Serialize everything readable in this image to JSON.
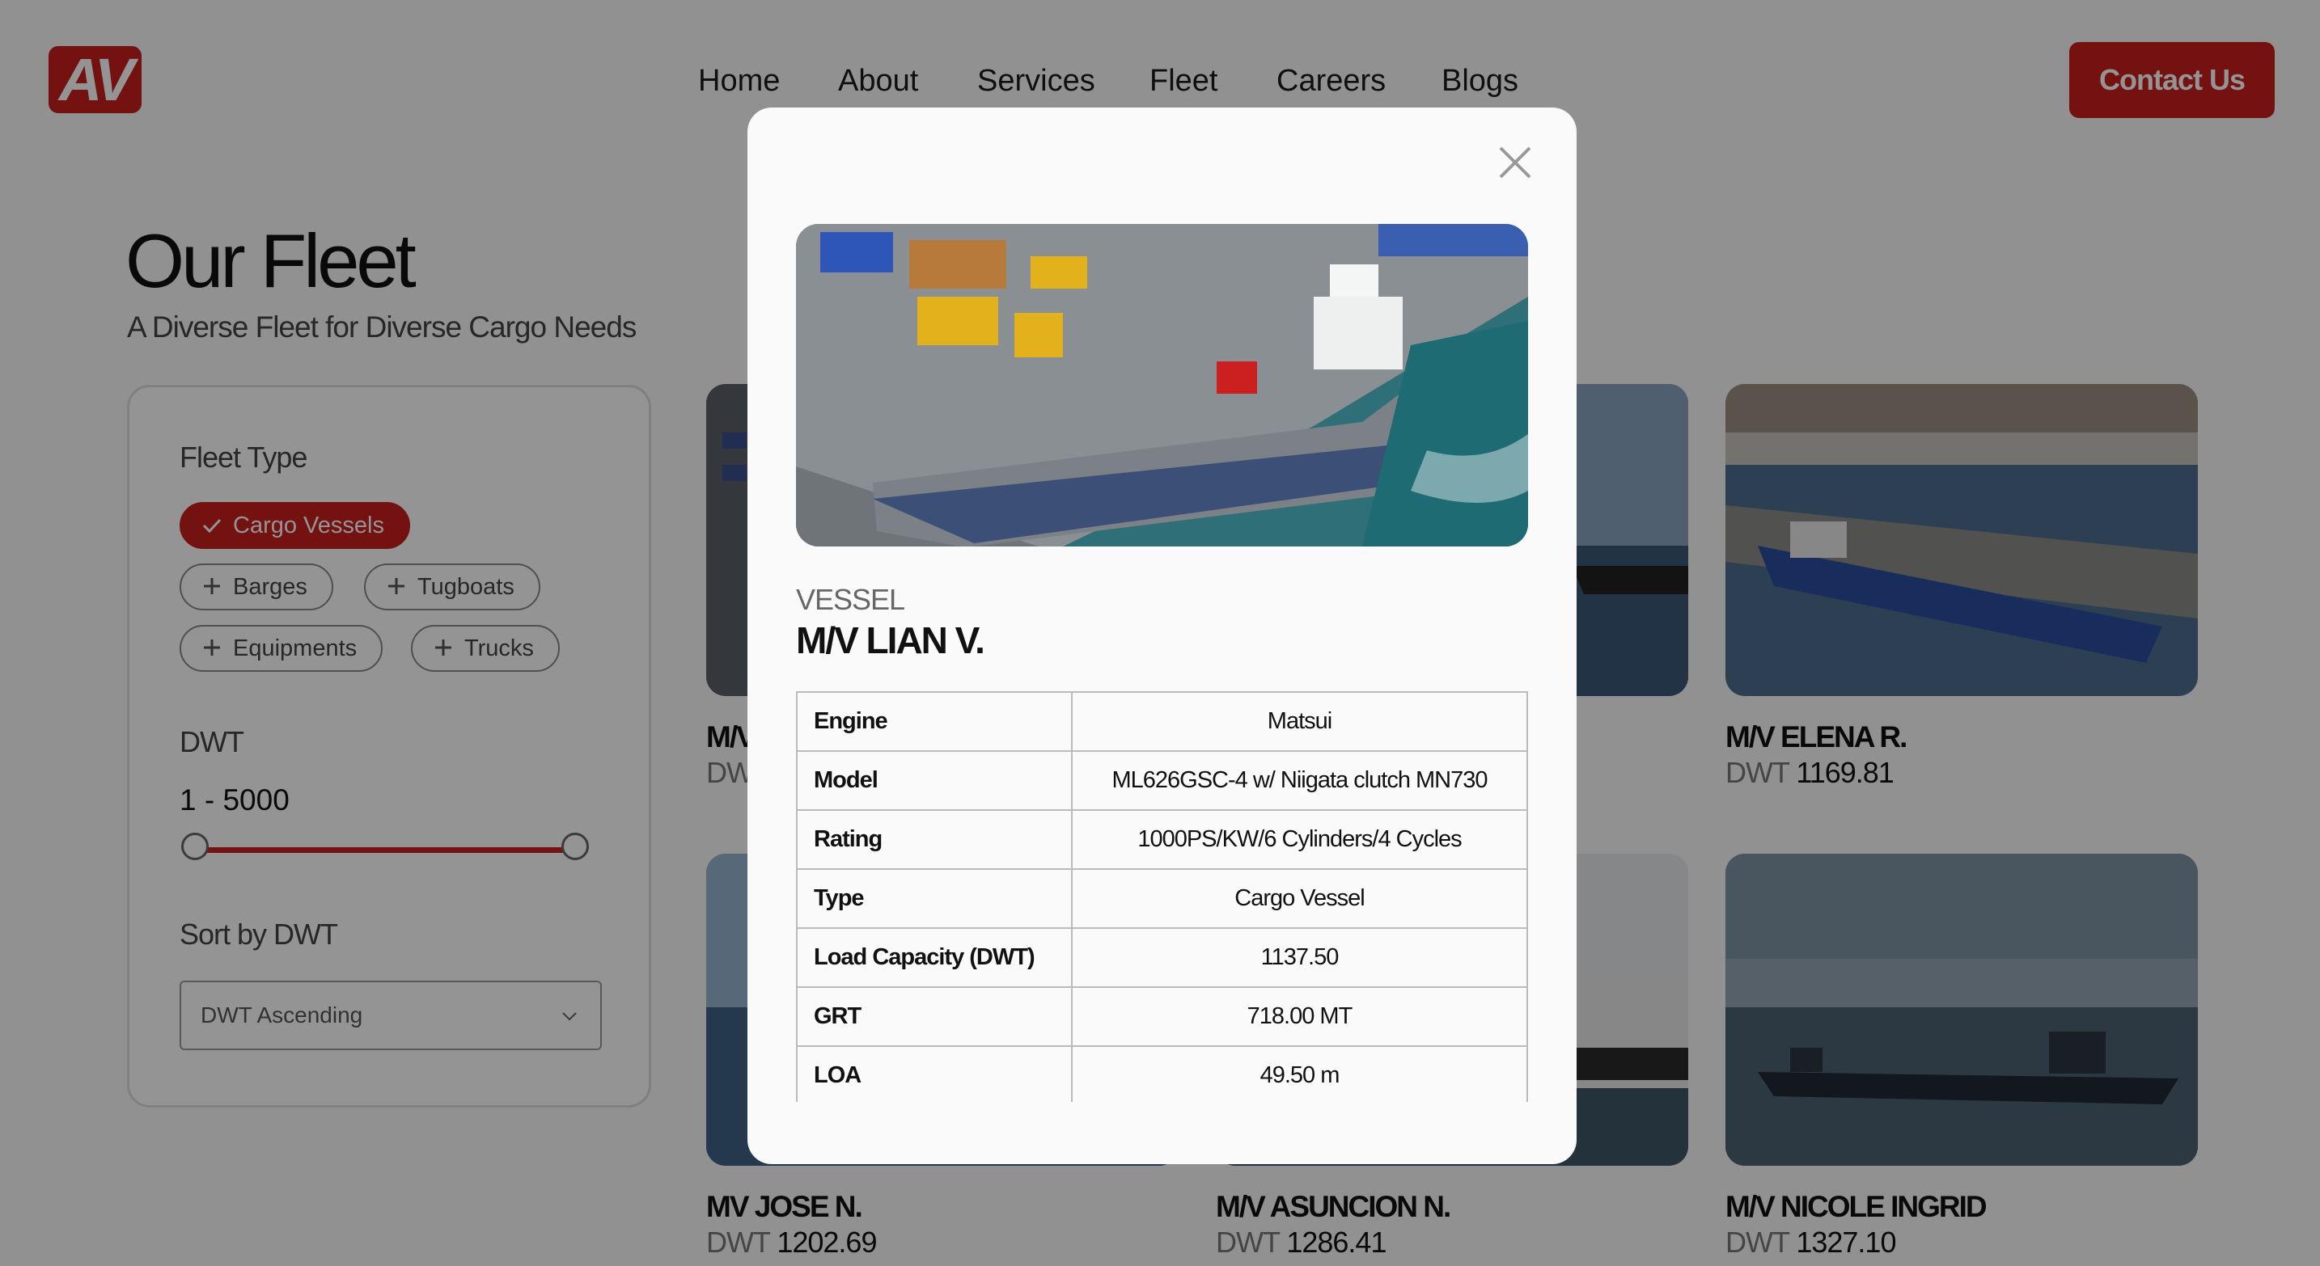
{
  "header": {
    "logo_text": "AV",
    "nav": [
      "Home",
      "About",
      "Services",
      "Fleet",
      "Careers",
      "Blogs"
    ],
    "contact_label": "Contact Us"
  },
  "page": {
    "title": "Our Fleet",
    "subtitle": "A Diverse Fleet for Diverse Cargo Needs"
  },
  "filters": {
    "fleet_type_label": "Fleet Type",
    "chips": [
      {
        "label": "Cargo Vessels",
        "active": true
      },
      {
        "label": "Barges",
        "active": false
      },
      {
        "label": "Tugboats",
        "active": false
      },
      {
        "label": "Equipments",
        "active": false
      },
      {
        "label": "Trucks",
        "active": false
      }
    ],
    "dwt_label": "DWT",
    "dwt_range": "1 - 5000",
    "sort_label": "Sort by DWT",
    "sort_value": "DWT Ascending"
  },
  "vessels": [
    {
      "name": "M/V",
      "dwt_label": "DWT",
      "dwt": ""
    },
    {
      "name": "",
      "dwt_label": "",
      "dwt": ""
    },
    {
      "name": "M/V ELENA R.",
      "dwt_label": "DWT",
      "dwt": "1169.81"
    },
    {
      "name": "MV JOSE N.",
      "dwt_label": "DWT",
      "dwt": "1202.69"
    },
    {
      "name": "M/V ASUNCION N.",
      "dwt_label": "DWT",
      "dwt": "1286.41"
    },
    {
      "name": "M/V NICOLE INGRID",
      "dwt_label": "DWT",
      "dwt": "1327.10"
    }
  ],
  "modal": {
    "kind": "VESSEL",
    "name": "M/V LIAN V.",
    "specs": [
      {
        "key": "Engine",
        "value": "Matsui"
      },
      {
        "key": "Model",
        "value": "ML626GSC-4 w/ Niigata clutch MN730"
      },
      {
        "key": "Rating",
        "value": "1000PS/KW/6 Cylinders/4 Cycles"
      },
      {
        "key": "Type",
        "value": "Cargo Vessel"
      },
      {
        "key": "Load Capacity (DWT)",
        "value": "1137.50"
      },
      {
        "key": "GRT",
        "value": "718.00 MT"
      },
      {
        "key": "LOA",
        "value": "49.50 m"
      }
    ]
  },
  "icons": {
    "close": "close-icon",
    "check": "check-icon",
    "plus": "plus-icon",
    "chevron": "chevron-down-icon"
  },
  "colors": {
    "brand_red": "#c81e1e"
  }
}
